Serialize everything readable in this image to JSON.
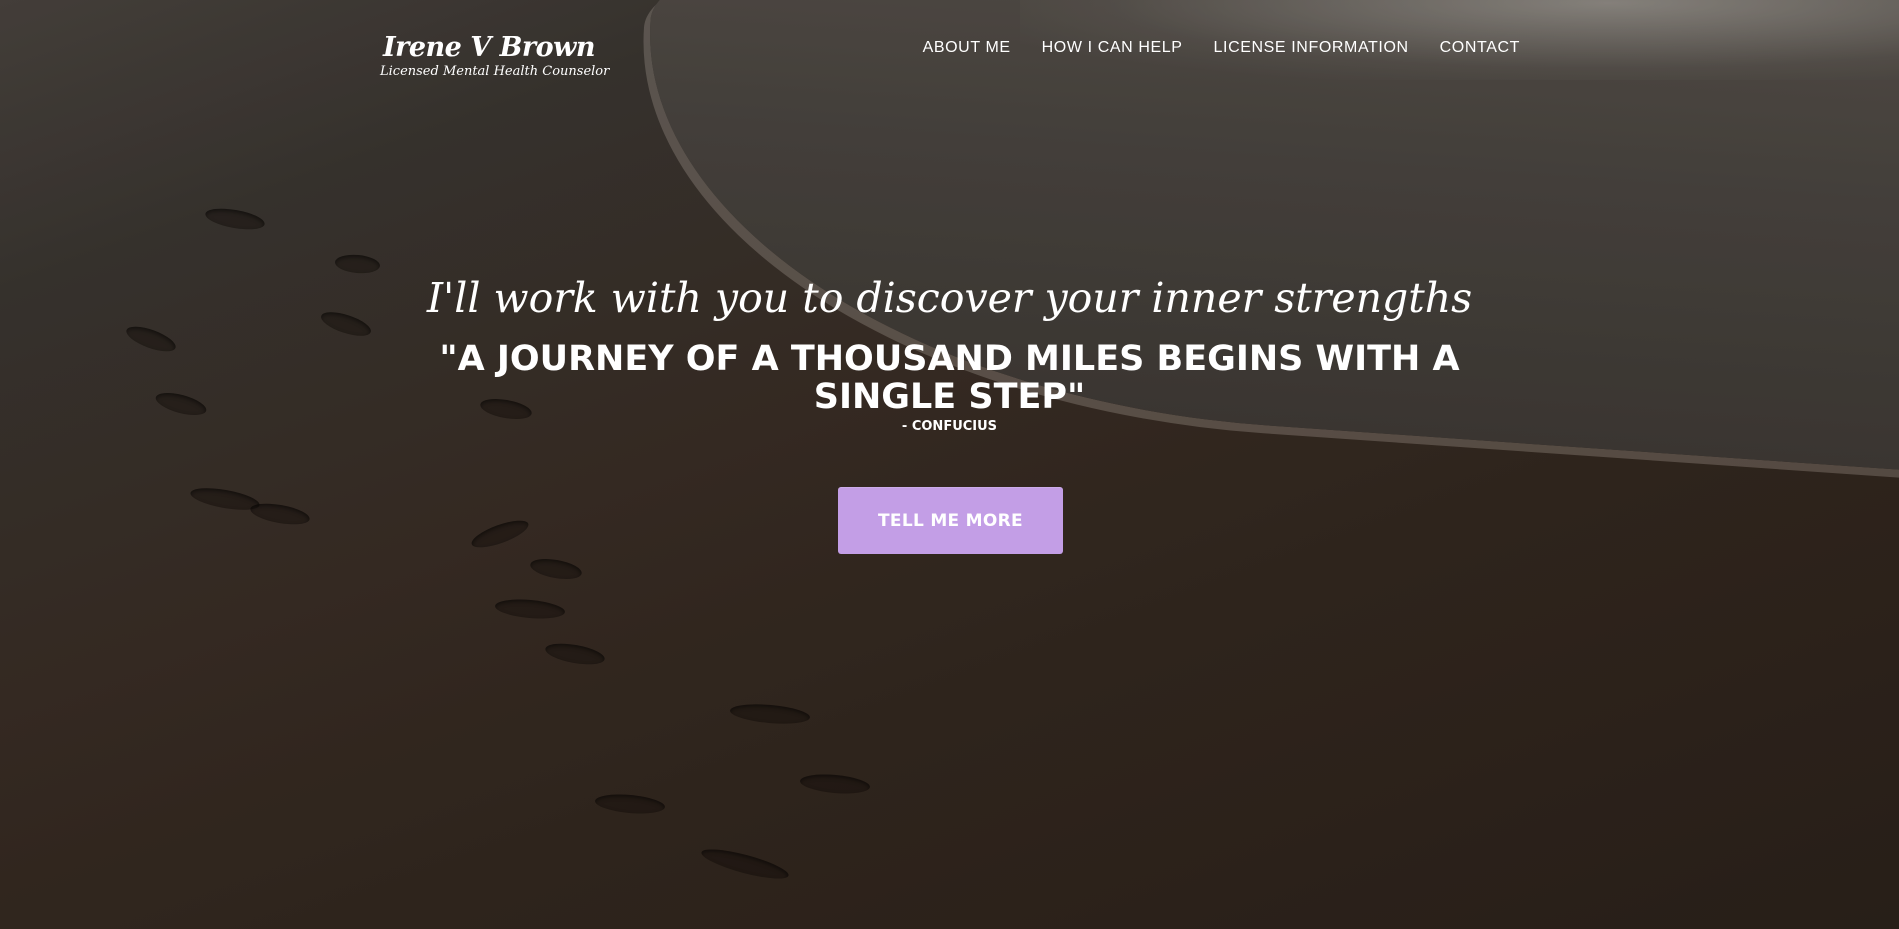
{
  "brand": {
    "name": "Irene V Brown",
    "subtitle": "Licensed Mental Health Counselor"
  },
  "nav": {
    "items": [
      {
        "label": "ABOUT ME"
      },
      {
        "label": "HOW I CAN HELP"
      },
      {
        "label": "LICENSE INFORMATION"
      },
      {
        "label": "CONTACT"
      }
    ]
  },
  "hero": {
    "tagline": "I'll work with you to discover your inner strengths",
    "quote": "\"A JOURNEY OF A THOUSAND MILES BEGINS WITH A SINGLE STEP\"",
    "author": "- CONFUCIUS",
    "cta_label": "TELL ME MORE"
  },
  "colors": {
    "accent": "#c39ee6",
    "text": "#ffffff",
    "background": "#2a221d"
  }
}
